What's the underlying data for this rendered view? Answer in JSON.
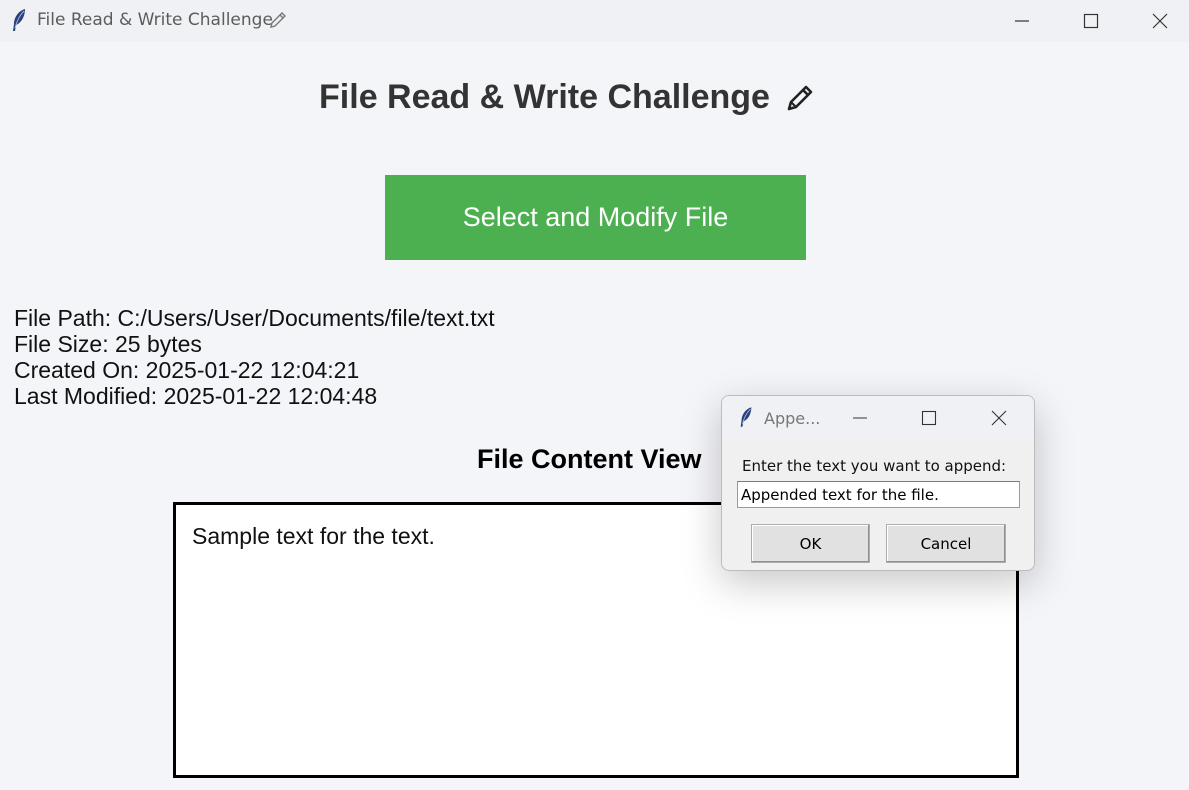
{
  "window": {
    "title": "File Read & Write Challenge",
    "icons": [
      "feather-icon",
      "pencil-icon",
      "minimize-icon",
      "maximize-icon",
      "close-icon"
    ]
  },
  "main": {
    "heading": "File Read & Write Challenge",
    "select_button": "Select and Modify File",
    "file_info": {
      "path": "File Path: C:/Users/User/Documents/file/text.txt",
      "size": "File Size: 25 bytes",
      "created": "Created On: 2025-01-22 12:04:21",
      "modified": "Last Modified: 2025-01-22 12:04:48"
    },
    "content_view_title": "File Content View",
    "content_text": "Sample text for the text."
  },
  "dialog": {
    "title": "Appe...",
    "prompt": "Enter the text you want to append:",
    "input_value": "Appended text for the file.",
    "ok_label": "OK",
    "cancel_label": "Cancel"
  },
  "colors": {
    "accent_button": "#4caf50",
    "background": "#f4f5f9",
    "heading_text": "#333333"
  }
}
